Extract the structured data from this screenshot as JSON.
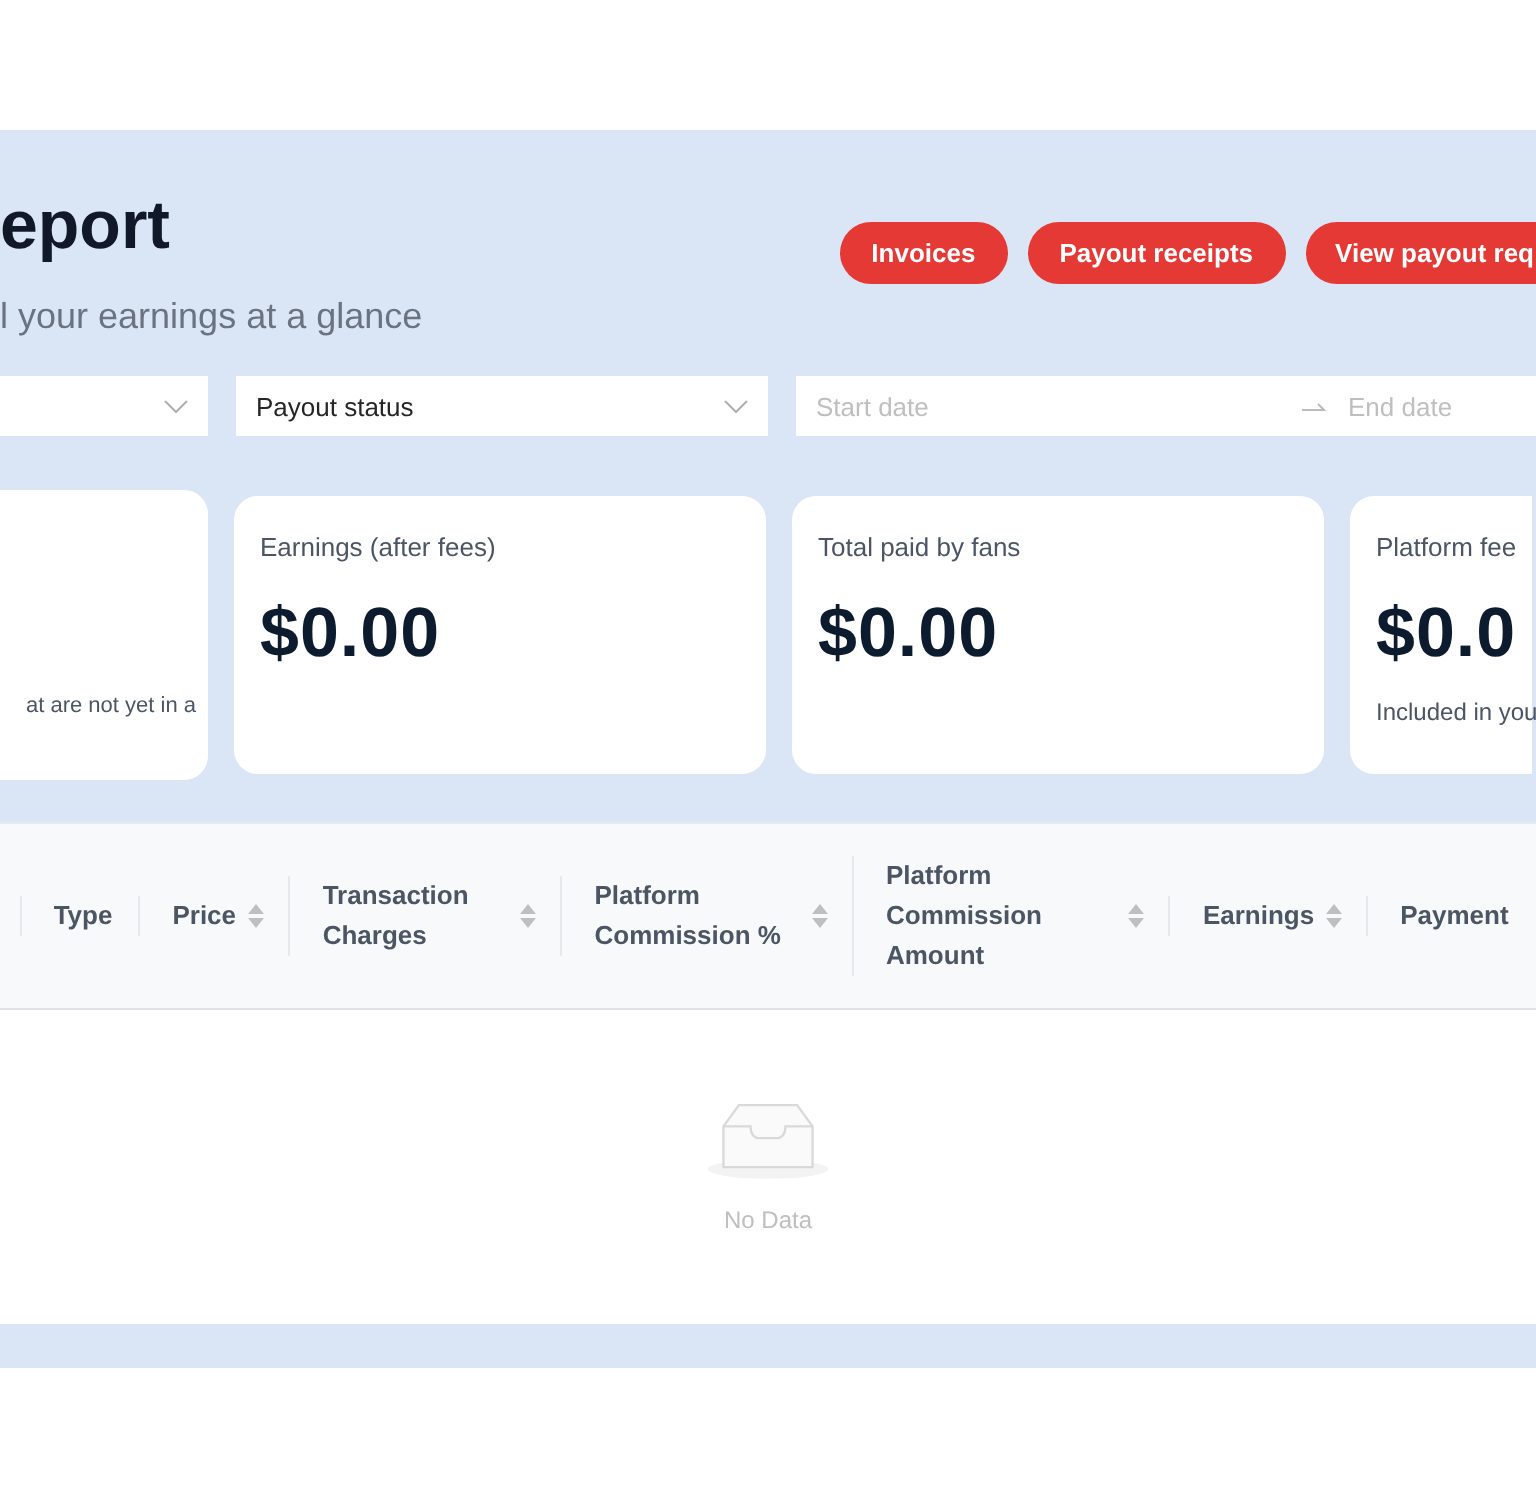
{
  "header": {
    "title": "eport",
    "subtitle": "l your earnings at a glance"
  },
  "buttons": [
    "Invoices",
    "Payout receipts",
    "View payout req"
  ],
  "filters": [
    {
      "kind": "select"
    },
    {
      "kind": "select",
      "value": "Payout status"
    },
    {
      "kind": "date_range",
      "start_placeholder": "Start date",
      "end_placeholder": "End date"
    }
  ],
  "cards": [
    {
      "note": "at are not yet in a"
    },
    {
      "label": "Earnings (after fees)",
      "value": "$0.00"
    },
    {
      "label": "Total paid by fans",
      "value": "$0.00"
    },
    {
      "label": "Platform fee",
      "value": "$0.0",
      "note": "Included in you"
    }
  ],
  "table": {
    "columns": [
      {
        "label": "Type",
        "sortable": false
      },
      {
        "label": "Price",
        "sortable": true
      },
      {
        "label": "Transaction Charges",
        "sortable": true
      },
      {
        "label": "Platform Commission %",
        "sortable": true
      },
      {
        "label": "Platform Commission Amount",
        "sortable": true
      },
      {
        "label": "Earnings",
        "sortable": true
      },
      {
        "label": "Payment",
        "sortable": false
      }
    ],
    "empty_text": "No Data"
  }
}
